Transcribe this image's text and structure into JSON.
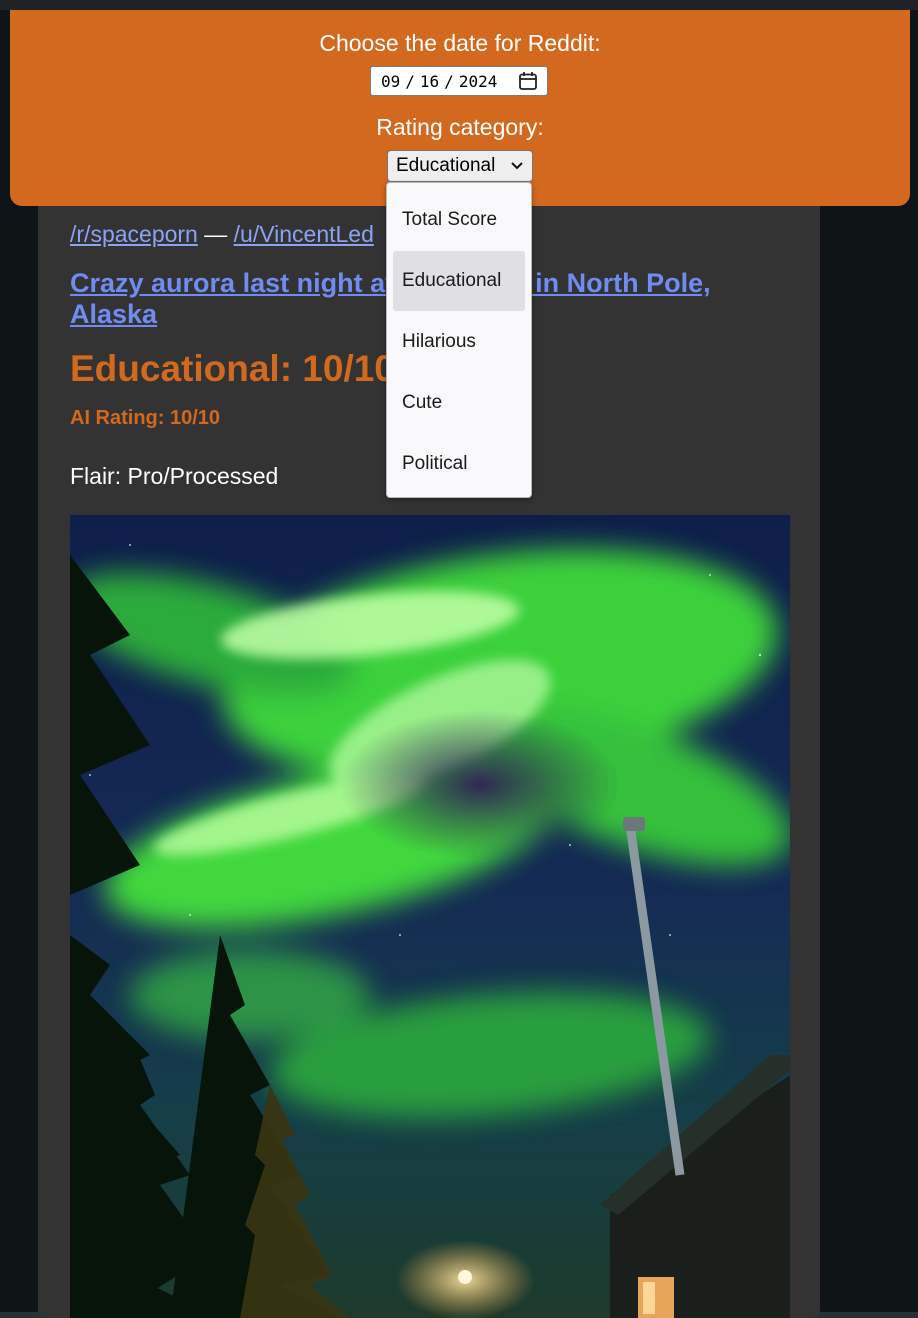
{
  "header": {
    "date_label": "Choose the date for Reddit:",
    "date": {
      "month": "09",
      "day": "16",
      "year": "2024"
    },
    "rating_label": "Rating category:",
    "selected_category": "Educational"
  },
  "dropdown": {
    "options": [
      "Total Score",
      "Educational",
      "Hilarious",
      "Cute",
      "Political"
    ],
    "selected_index": 1
  },
  "post": {
    "subreddit": "/r/spaceporn",
    "separator": "—",
    "user": "/u/VincentLed",
    "title": "Crazy aurora last night at my house in North Pole, Alaska",
    "score_heading": "Educational: 10/10",
    "ai_rating": "AI Rating: 10/10",
    "flair": "Flair: Pro/Processed"
  },
  "icons": {
    "date_picker": "calendar-icon",
    "select": "chevron-down-icon"
  },
  "colors": {
    "accent": "#d2691e",
    "card": "#333333",
    "background": "#0f1416",
    "link": "#8aa3f2",
    "title_link": "#6f8cf0",
    "selected_option": "#e0dfe4"
  }
}
